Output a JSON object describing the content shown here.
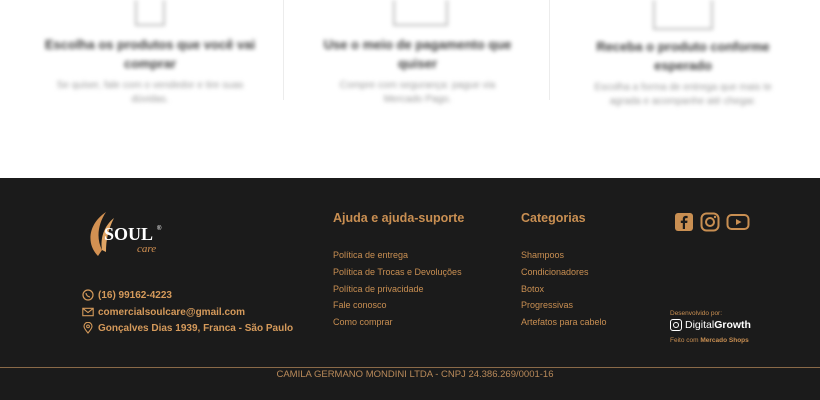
{
  "features": [
    {
      "title": "Escolha os produtos que você vai comprar",
      "description": "Se quiser, fale com o vendedor e tire suas dúvidas."
    },
    {
      "title": "Use o meio de pagamento que quiser",
      "description": "Compre com segurança: pague via Mercado Pago."
    },
    {
      "title": "Receba o produto conforme esperado",
      "description": "Escolha a forma de entrega que mais te agrada e acompanhe até chegar."
    }
  ],
  "footer": {
    "brand": {
      "name": "SOUL",
      "sub": "care",
      "mark": "®"
    },
    "contacts": {
      "phone": "(16) 99162-4223",
      "email": "comercialsoulcare@gmail.com",
      "address": "Gonçalves Dias 1939, Franca - São Paulo"
    },
    "help": {
      "title": "Ajuda e ajuda-suporte",
      "links": [
        "Política de entrega",
        "Política de Trocas e Devoluções",
        "Política de privacidade",
        "Fale conosco",
        "Como comprar"
      ]
    },
    "categories": {
      "title": "Categorias",
      "links": [
        "Shampoos",
        "Condicionadores",
        "Botox",
        "Progressivas",
        "Artefatos para cabelo"
      ]
    },
    "social": [
      "facebook-icon",
      "instagram-icon",
      "youtube-icon"
    ],
    "developer": {
      "label": "Desenvolvido por:",
      "brand_a": "Digital",
      "brand_b": "Growth",
      "made_prefix": "Feito com",
      "made_brand": "Mercado Shops"
    },
    "legal": "CAMILA GERMANO MONDINI LTDA - CNPJ 24.386.269/0001-16"
  },
  "colors": {
    "footer_bg": "#1b1b1b",
    "accent": "#c98f52"
  }
}
